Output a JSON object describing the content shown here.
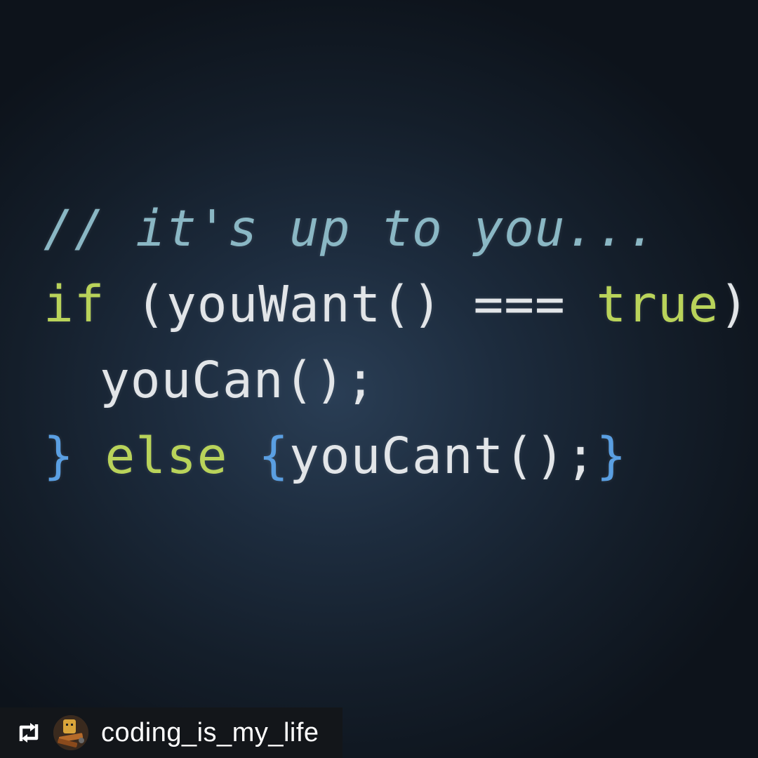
{
  "code_lines": {
    "line1": {
      "comment": "// it's up to you..."
    },
    "line2": {
      "if": "if",
      "open": " (youWant() === ",
      "true": "true",
      "close": ") ",
      "brace": "{"
    },
    "line3": {
      "call": "youCan();"
    },
    "line4": {
      "brace_close": "}",
      "else": " else ",
      "brace_open": "{",
      "call": "youCant();",
      "brace_end": "}"
    }
  },
  "colors": {
    "background": "#1d2c3e",
    "comment": "#8ab7c4",
    "keyword": "#b9d35a",
    "plain": "#e2e5e8",
    "brace": "#5a9fe2"
  },
  "attribution": {
    "icon": "repost-icon",
    "avatar": "avatar",
    "username": "coding_is_my_life"
  }
}
